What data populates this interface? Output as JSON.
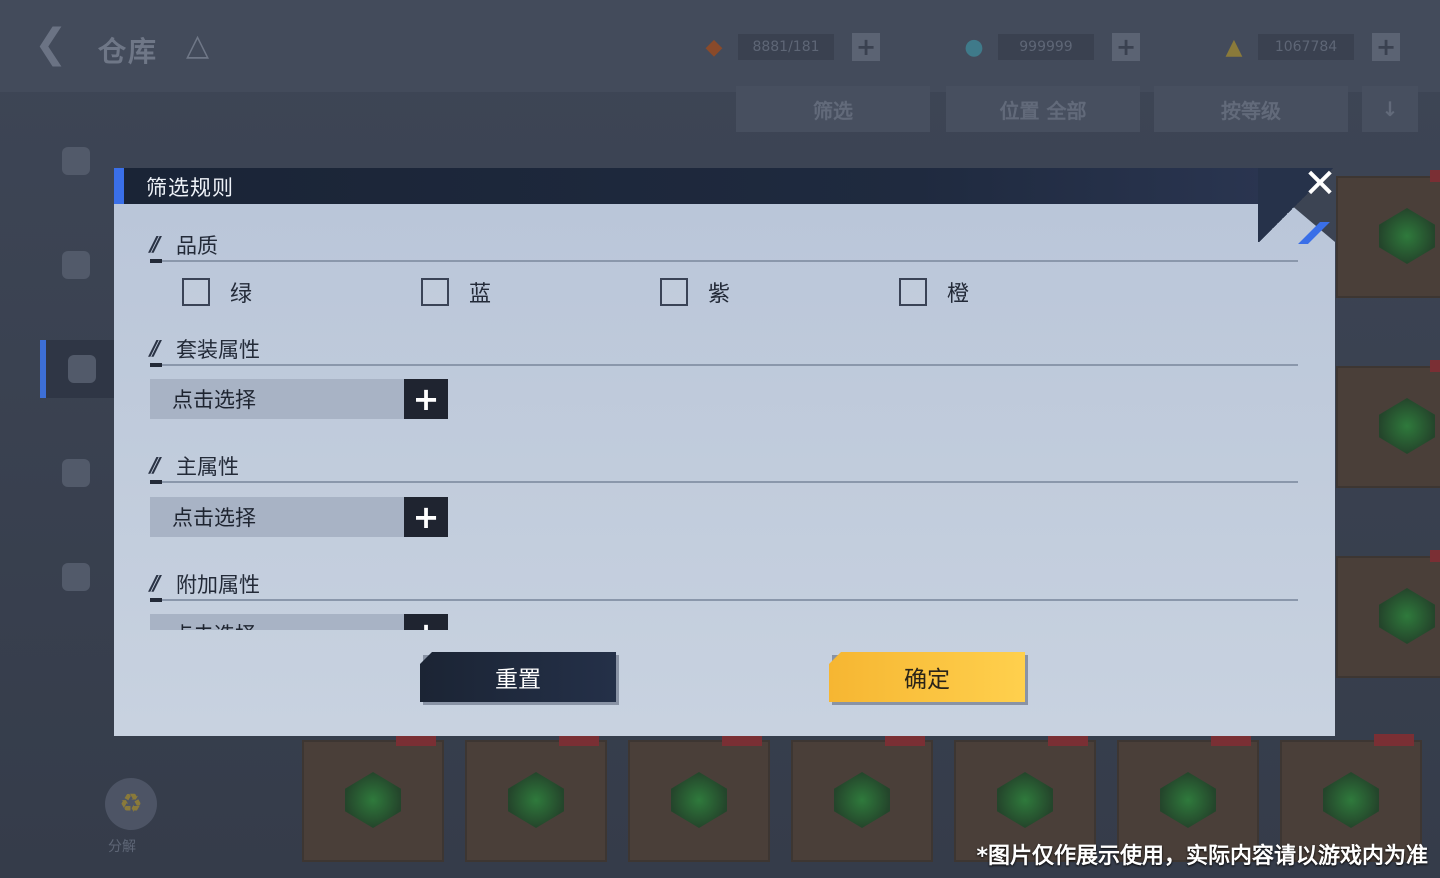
{
  "background": {
    "page_title": "仓库",
    "resources": [
      {
        "icon": "crystal-icon",
        "value": "8881/181"
      },
      {
        "icon": "gem-icon",
        "value": "999999"
      },
      {
        "icon": "ticket-icon",
        "value": "1067784"
      }
    ],
    "filter_buttons": [
      "筛选",
      "位置 全部",
      "按等级"
    ],
    "recycle_label": "分解"
  },
  "dialog": {
    "title": "筛选规则",
    "sections": {
      "quality": {
        "title": "品质",
        "options": [
          "绿",
          "蓝",
          "紫",
          "橙"
        ]
      },
      "set_attr": {
        "title": "套装属性",
        "picker_label": "点击选择"
      },
      "main_attr": {
        "title": "主属性",
        "picker_label": "点击选择"
      },
      "extra_attr": {
        "title": "附加属性",
        "picker_label": "点击选择"
      }
    },
    "reset_label": "重置",
    "confirm_label": "确定"
  },
  "disclaimer": "*图片仅作展示使用，实际内容请以游戏内为准",
  "colors": {
    "accent_blue": "#3a6fe8",
    "confirm_yellow": "#ffc63f",
    "dialog_bg": "#c1ccdc"
  }
}
